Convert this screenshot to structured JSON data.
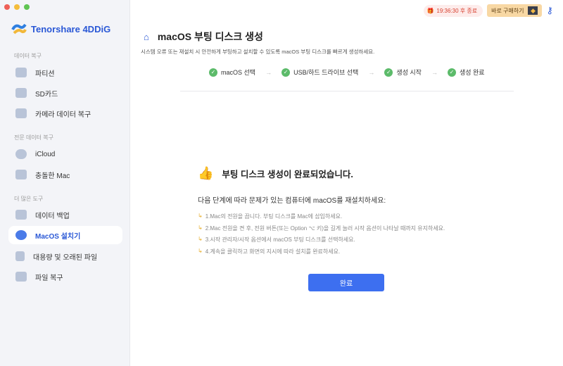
{
  "app": {
    "name": "Tenorshare 4DDiG"
  },
  "sidebar": {
    "sections": [
      {
        "label": "데이터 복구"
      },
      {
        "label": "전문 데이터 복구"
      },
      {
        "label": "더 많은 도구"
      }
    ],
    "items": [
      {
        "label": "파티션"
      },
      {
        "label": "SD카드"
      },
      {
        "label": "카메라 데이터 복구"
      },
      {
        "label": "iCloud"
      },
      {
        "label": "충돌한 Mac"
      },
      {
        "label": "데이터 백업"
      },
      {
        "label": "MacOS 설치기"
      },
      {
        "label": "대용량 및 오래된 파일"
      },
      {
        "label": "파일 복구"
      }
    ]
  },
  "header": {
    "timer": "19:36:30 후 종료",
    "buy": "바로 구매하기"
  },
  "main": {
    "title": "macOS 부팅 디스크 생성",
    "subtitle": "시스템 오류 또는 재설치 시 안전하게 부팅하고 설치할 수 있도록 macOS 부팅 디스크를 빠르게 생성하세요.",
    "steps": [
      {
        "label": "macOS 선택"
      },
      {
        "label": "USB/하드 드라이브 선택"
      },
      {
        "label": "생성 시작"
      },
      {
        "label": "생성 완료"
      }
    ],
    "done_title": "부팅 디스크 생성이 완료되었습니다.",
    "intro": "다음 단계에 따라 문제가 있는 컴퓨터에 macOS를 재설치하세요:",
    "instructions": [
      "1.Mac의 전원을 끕니다. 부팅 디스크를 Mac에 삽입하세요.",
      "2.Mac 전원을 켠 후, 전원 버튼(또는 Option ⌥ 키)을 길게 눌러 시작 옵션이 나타날 때까지 유지하세요.",
      "3.시작 관리자/시작 옵션에서 macOS 부팅 디스크를 선택하세요.",
      "4.계속을 클릭하고 화면의 지시에 따라 설치를 완료하세요."
    ],
    "complete_button": "완료"
  },
  "colors": {
    "accent": "#3d6ff0",
    "success": "#5cbb6a"
  }
}
